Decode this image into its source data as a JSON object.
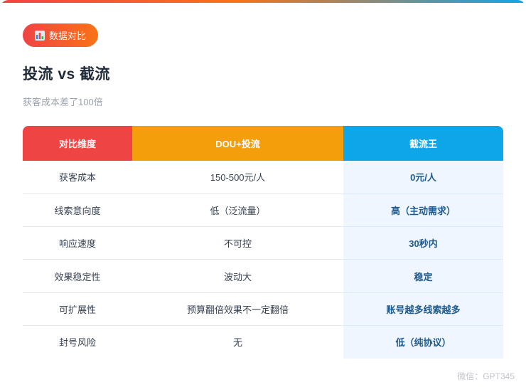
{
  "tag": {
    "icon": "bar-chart-icon",
    "label": "数据对比"
  },
  "title": "投流 vs 截流",
  "subtitle": "获客成本差了100倍",
  "colors": {
    "red": "#ef4444",
    "orange": "#f59e0b",
    "blue": "#0ea5e9",
    "highlight_bg": "#eff6ff"
  },
  "table": {
    "headers": [
      "对比维度",
      "DOU+投流",
      "截流王"
    ],
    "rows": [
      {
        "dim": "获客成本",
        "dou": "150-500元/人",
        "jl": "0元/人"
      },
      {
        "dim": "线索意向度",
        "dou": "低（泛流量）",
        "jl": "高（主动需求）"
      },
      {
        "dim": "响应速度",
        "dou": "不可控",
        "jl": "30秒内"
      },
      {
        "dim": "效果稳定性",
        "dou": "波动大",
        "jl": "稳定"
      },
      {
        "dim": "可扩展性",
        "dou": "预算翻倍效果不一定翻倍",
        "jl": "账号越多线索越多"
      },
      {
        "dim": "封号风险",
        "dou": "无",
        "jl": "低（纯协议）"
      }
    ]
  },
  "watermark": "微信：GPT345"
}
